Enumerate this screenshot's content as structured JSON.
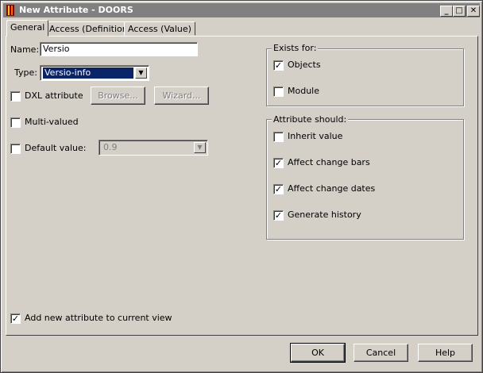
{
  "window": {
    "title": "New Attribute - DOORS"
  },
  "title_buttons": {
    "minimize": "_",
    "maximize": "□",
    "close": "✕"
  },
  "tabs": [
    {
      "label": "General"
    },
    {
      "label": "Access (Definition)"
    },
    {
      "label": "Access (Value)"
    }
  ],
  "form": {
    "name_label": "Name:",
    "name_value": "Versio",
    "type_label": "Type:",
    "type_value": "Versio-info",
    "dxl_label": "DXL attribute",
    "browse_label": "Browse...",
    "wizard_label": "Wizard...",
    "multi_valued_label": "Multi-valued",
    "default_value_label": "Default value:",
    "default_value": "0.9",
    "add_to_view_label": "Add new attribute to current view"
  },
  "exists_for": {
    "title": "Exists for:",
    "objects": "Objects",
    "module": "Module"
  },
  "attribute_should": {
    "title": "Attribute should:",
    "inherit": "Inherit value",
    "change_bars": "Affect change bars",
    "change_dates": "Affect change dates",
    "history": "Generate history"
  },
  "buttons": {
    "ok": "OK",
    "cancel": "Cancel",
    "help": "Help"
  },
  "check_mark": "✓",
  "colors": {
    "dialog_bg": "#d4d0c8",
    "titlebar_inactive": "#808080",
    "selection": "#0a246a"
  }
}
